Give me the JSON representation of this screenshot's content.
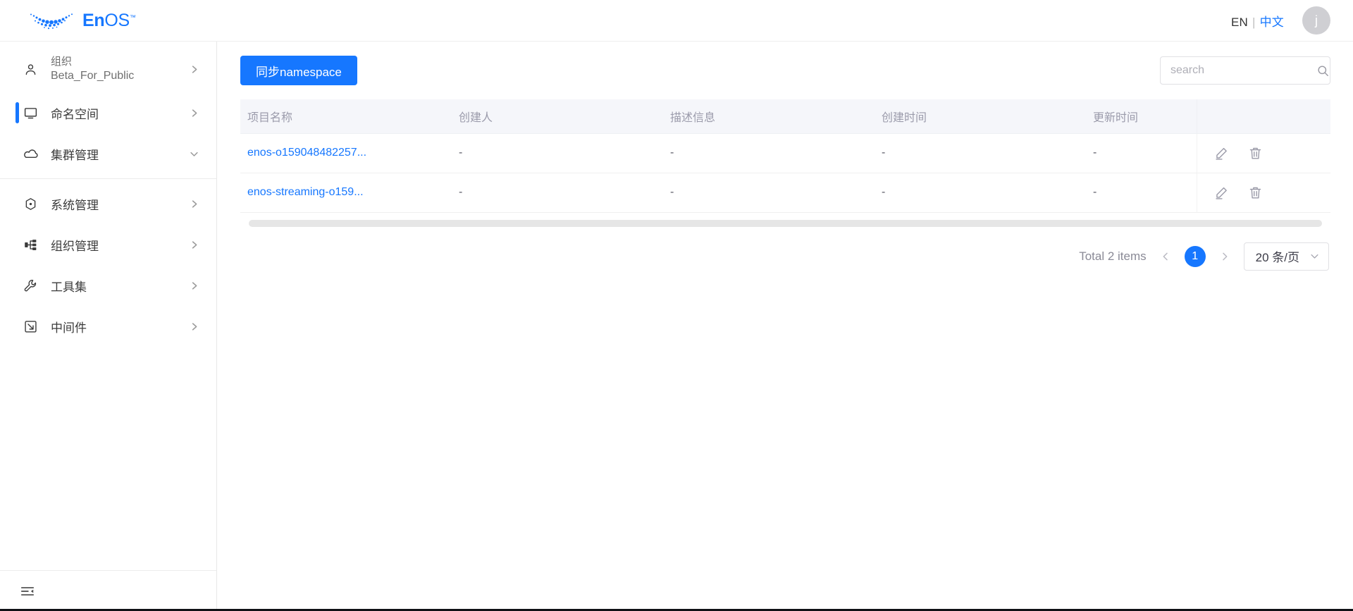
{
  "header": {
    "brand_name_bold": "En",
    "brand_name_light": "OS",
    "brand_tm": "™",
    "brand_icon": "enos-swoosh-logo",
    "lang_en": "EN",
    "lang_sep": "|",
    "lang_zh": "中文",
    "avatar_initial": "j",
    "accent_color": "#1677ff"
  },
  "sidebar": {
    "org": {
      "icon": "user-icon",
      "title": "组织",
      "name": "Beta_For_Public",
      "arrow_icon": "chevron-right-icon"
    },
    "items": [
      {
        "icon": "monitor-icon",
        "label": "命名空间",
        "arrow_icon": "chevron-right-icon",
        "active": true
      },
      {
        "icon": "cloud-icon",
        "label": "集群管理",
        "arrow_icon": "chevron-down-icon",
        "active": false
      },
      {
        "icon": "hexagon-dot-icon",
        "label": "系统管理",
        "arrow_icon": "chevron-right-icon",
        "active": false
      },
      {
        "icon": "sitemap-icon",
        "label": "组织管理",
        "arrow_icon": "chevron-right-icon",
        "active": false
      },
      {
        "icon": "wrench-icon",
        "label": "工具集",
        "arrow_icon": "chevron-right-icon",
        "active": false
      },
      {
        "icon": "middleware-icon",
        "label": "中间件",
        "arrow_icon": "chevron-right-icon",
        "active": false
      }
    ],
    "footer": {
      "collapse_icon": "collapse-sidebar-icon"
    }
  },
  "toolbar": {
    "sync_label": "同步namespace",
    "search_placeholder": "search",
    "search_value": "",
    "search_icon": "search-icon"
  },
  "table": {
    "columns": [
      "项目名称",
      "创建人",
      "描述信息",
      "创建时间",
      "更新时间",
      ""
    ],
    "rows": [
      {
        "name": "enos-o159048482257...",
        "creator": "-",
        "description": "-",
        "created_at": "-",
        "updated_at": "-",
        "edit_icon": "pencil-icon",
        "delete_icon": "trash-icon"
      },
      {
        "name": "enos-streaming-o159...",
        "creator": "-",
        "description": "-",
        "created_at": "-",
        "updated_at": "-",
        "edit_icon": "pencil-icon",
        "delete_icon": "trash-icon"
      }
    ]
  },
  "pagination": {
    "total_text": "Total 2 items",
    "prev_icon": "chevron-left-icon",
    "next_icon": "chevron-right-icon",
    "current_page": "1",
    "page_size_label": "20 条/页",
    "page_size_chevron": "chevron-down-icon"
  }
}
